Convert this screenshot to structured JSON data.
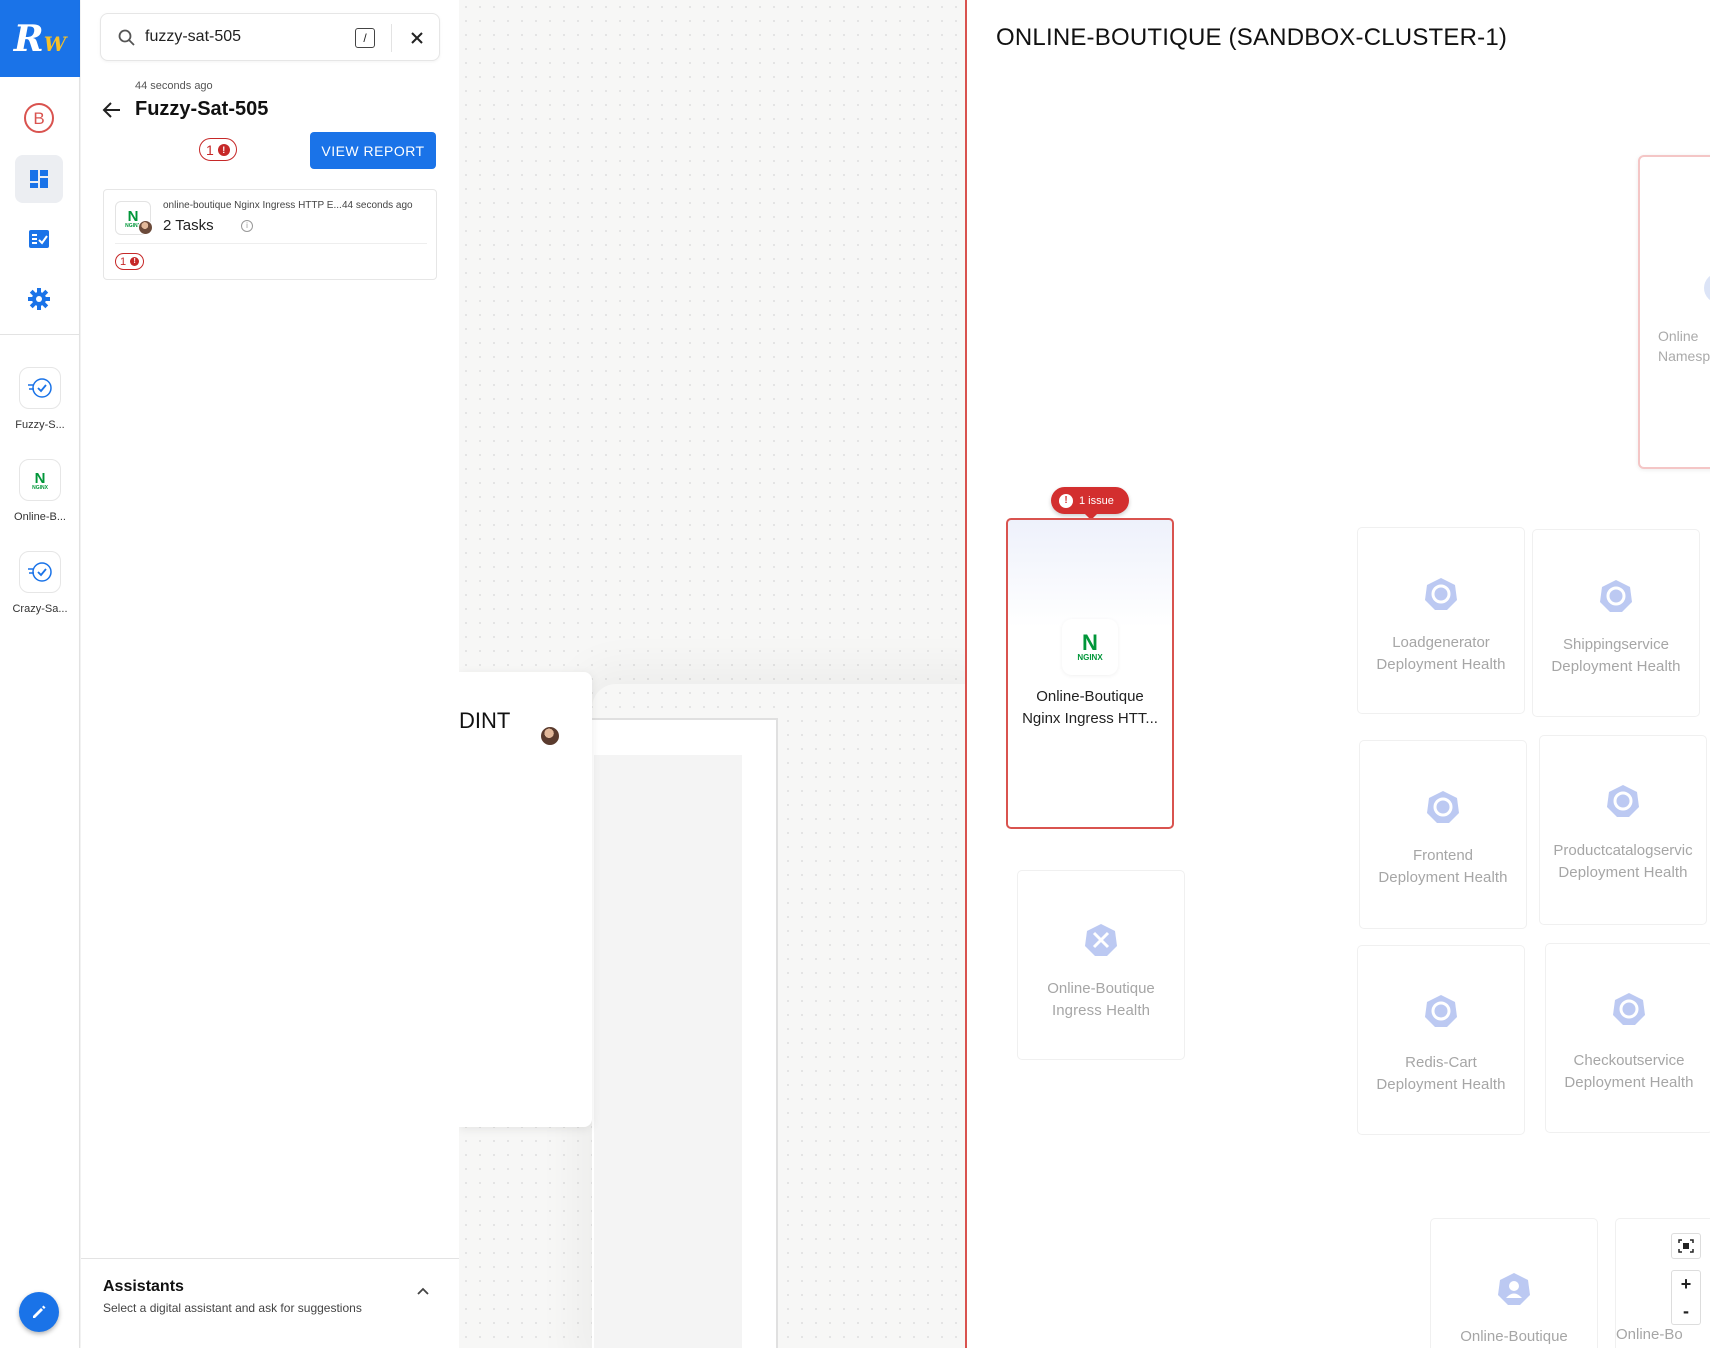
{
  "rail": {
    "logo_text": "R",
    "logo_sup": "W",
    "workspace_letter": "B",
    "apps": [
      {
        "label": "Fuzzy-S..."
      },
      {
        "label": "Online-B..."
      },
      {
        "label": "Crazy-Sa..."
      }
    ]
  },
  "panel": {
    "search": {
      "value": "fuzzy-sat-505",
      "shortcut": "/"
    },
    "time_ago": "44 seconds ago",
    "title": "Fuzzy-Sat-505",
    "issue_count": "1",
    "view_report_label": "VIEW REPORT",
    "card": {
      "name": "online-boutique Nginx Ingress HTTP E...",
      "time_ago": "44 seconds ago",
      "tasks": "2 Tasks",
      "issue_count": "1"
    },
    "assistants": {
      "title": "Assistants",
      "subtitle": "Select a digital assistant and ask for suggestions"
    }
  },
  "canvas": {
    "card_title_fragment": "DINT"
  },
  "right": {
    "title": "ONLINE-BOUTIQUE (SANDBOX-CLUSTER-1)",
    "namespace_card": {
      "line1": "Online",
      "line2": "Namesp"
    },
    "issue_pill": "1 issue",
    "active_node": {
      "line1": "Online-Boutique",
      "line2": "Nginx Ingress HTT..."
    },
    "nodes": [
      {
        "line1": "Loadgenerator",
        "line2": "Deployment Health"
      },
      {
        "line1": "Shippingservice",
        "line2": "Deployment Health"
      },
      {
        "line1": "Frontend",
        "line2": "Deployment Health"
      },
      {
        "line1": "Productcatalogservic",
        "line2": "Deployment Health"
      },
      {
        "line1": "Online-Boutique",
        "line2": "Ingress Health"
      },
      {
        "line1": "Redis-Cart",
        "line2": "Deployment Health"
      },
      {
        "line1": "Checkoutservice",
        "line2": "Deployment Health"
      },
      {
        "line1": "Online-Boutique",
        "line2": ""
      },
      {
        "line1": "Online-Bo",
        "line2": ""
      }
    ],
    "zoom": {
      "in": "+",
      "out": "-"
    }
  },
  "colors": {
    "primary": "#1a73e8",
    "error": "#d32f2f",
    "nginx_green": "#009639",
    "k8s_blue": "#6d8be0"
  },
  "icons": [
    "logo",
    "workspace-icon",
    "dashboard-icon",
    "tasks-icon",
    "settings-icon",
    "search-icon",
    "close-icon",
    "back-arrow-icon",
    "nginx-icon",
    "k8s-icon",
    "fit-view-icon",
    "edit-icon",
    "chevron-up-icon"
  ]
}
